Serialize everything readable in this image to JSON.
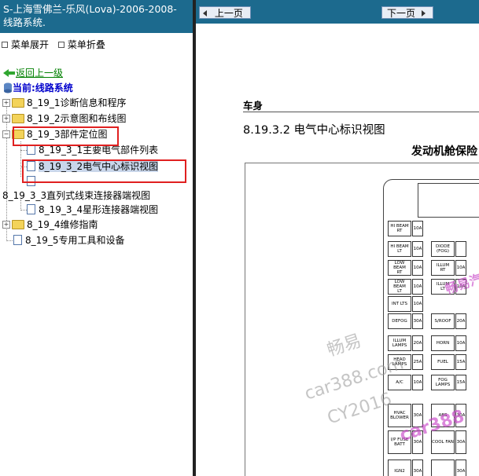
{
  "sidebar": {
    "title": "S-上海雪佛兰-乐风(Lova)-2006-2008- 线路系统.",
    "expand_all": "菜单展开",
    "collapse_all": "菜单折叠",
    "back": "返回上一级",
    "current": "当前:线路系统",
    "tree": [
      {
        "label": "8_19_1诊断信息和程序"
      },
      {
        "label": "8_19_2示意图和布线图"
      },
      {
        "label": "8_19_3部件定位图"
      },
      {
        "label": "8_19_3_1主要电气部件列表"
      },
      {
        "label": "8_19_3_2电气中心标识视图"
      },
      {
        "label": "8_19_3_3直列式线束连接器端视图"
      },
      {
        "label": "8_19_3_4星形连接器端视图"
      },
      {
        "label": "8_19_4维修指南"
      },
      {
        "label": "8_19_5专用工具和设备"
      }
    ]
  },
  "toolbar": {
    "prev": "上一页",
    "next": "下一页"
  },
  "document": {
    "section": "车身",
    "heading": "8.19.3.2 电气中心标识视图",
    "subtitle": "发动机舱保险",
    "fuses_left": [
      {
        "name": "HI BEAM\nRT",
        "amp": "10A"
      },
      {
        "name": "HI BEAM\nLT",
        "amp": "10A"
      },
      {
        "name": "LOW BEAM\nRT",
        "amp": "10A"
      },
      {
        "name": "LOW BEAM\nLT",
        "amp": "10A"
      },
      {
        "name": "INT LTS",
        "amp": "10A"
      },
      {
        "name": "DEFOG",
        "amp": "30A"
      },
      {
        "name": "ILLUM\nLAMPS",
        "amp": "20A"
      },
      {
        "name": "HEAD\nLAMPS",
        "amp": "25A"
      },
      {
        "name": "A/C",
        "amp": "10A"
      },
      {
        "name": "HVAC\nBLOWER",
        "amp": "30A"
      },
      {
        "name": "I/P FUSE\nBATT",
        "amp": "30A"
      },
      {
        "name": "IGN2",
        "amp": "30A"
      }
    ],
    "fuses_right": [
      {
        "name": "DIODE\n(FOG)",
        "amp": ""
      },
      {
        "name": "ILLUM\nRT",
        "amp": "10A"
      },
      {
        "name": "ILLUM\nLT",
        "amp": "10A"
      },
      {
        "name": "S/ROOF",
        "amp": "20A"
      },
      {
        "name": "HORN",
        "amp": "10A"
      },
      {
        "name": "FUEL",
        "amp": "15A"
      },
      {
        "name": "FOG\nLAMPS",
        "amp": "15A"
      },
      {
        "name": "ABS",
        "amp": "30A"
      },
      {
        "name": "COOL FAN",
        "amp": "30A"
      },
      {
        "name": "",
        "amp": "30A"
      }
    ],
    "watermarks": [
      "畅易",
      "car388.com",
      "CY2016",
      "car388",
      "畅易汽"
    ]
  }
}
